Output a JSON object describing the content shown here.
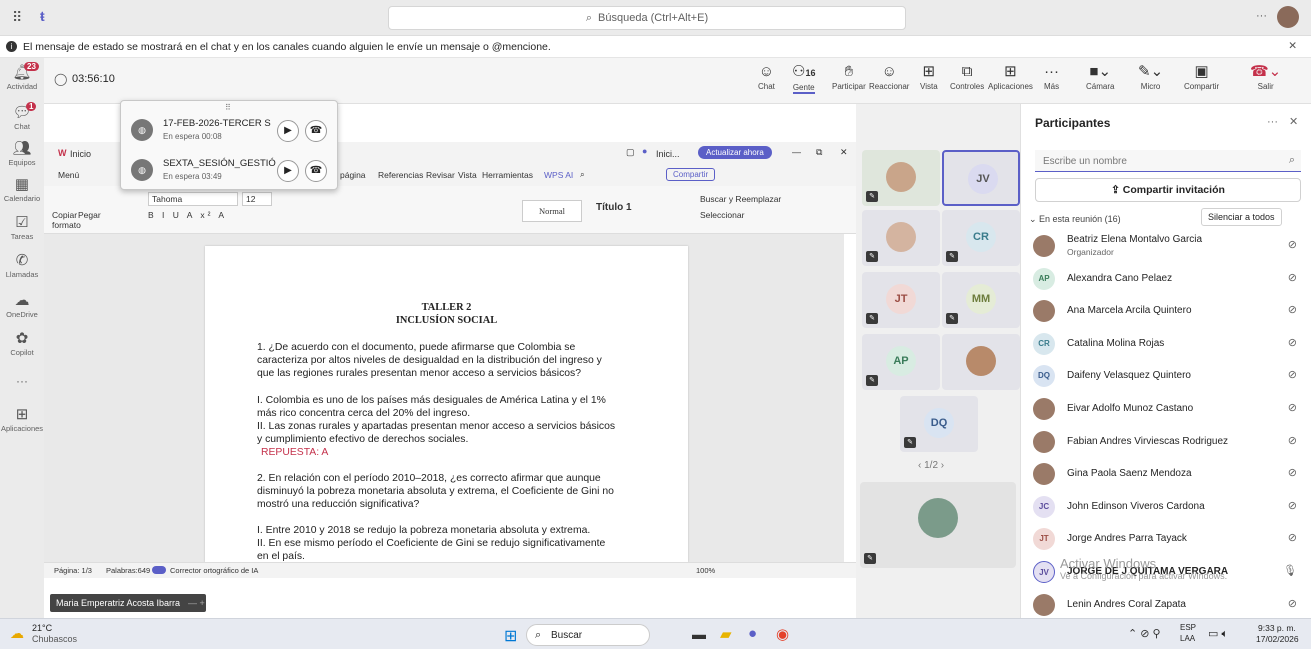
{
  "topbar": {
    "search_placeholder": "Búsqueda (Ctrl+Alt+E)",
    "more": "···"
  },
  "infobar": {
    "message": "El mensaje de estado se mostrará en el chat y en los canales cuando alguien le envíe un mensaje o @mencione.",
    "close": "✕"
  },
  "rail": [
    {
      "label": "Actividad",
      "badge": "23"
    },
    {
      "label": "Chat",
      "badge": "1"
    },
    {
      "label": "Equipos"
    },
    {
      "label": "Calendario"
    },
    {
      "label": "Tareas"
    },
    {
      "label": "Llamadas"
    },
    {
      "label": "OneDrive"
    },
    {
      "label": "Copilot"
    },
    {
      "label": "···"
    },
    {
      "label": "Aplicaciones"
    }
  ],
  "meeting": {
    "timer": "03:56:10",
    "people_count": "16",
    "buttons": {
      "chat": "Chat",
      "people": "Gente",
      "raise": "Participar",
      "react": "Reaccionar",
      "view": "Vista",
      "controls": "Controles",
      "apps": "Aplicaciones",
      "more": "Más",
      "camera": "Cámara",
      "mic": "Micro",
      "share": "Compartir",
      "leave": "Salir"
    }
  },
  "held_calls": [
    {
      "title": "17-FEB-2026-TERCER S",
      "status": "En espera  00:08"
    },
    {
      "title": "SEXTA_SESIÓN_GESTIÓ",
      "status": "En espera  03:49"
    }
  ],
  "word": {
    "tab_home": "Inicio",
    "menu": "Menú",
    "tabs": [
      "página",
      "Referencias",
      "Revisar",
      "Vista",
      "Herramientas",
      "WPS AI"
    ],
    "start_label": "Inici...",
    "update": "Actualizar ahora",
    "share": "Compartir",
    "copy": "Copiar",
    "paste": "Pegar",
    "format": "formato",
    "font": "Tahoma",
    "size": "12",
    "style_normal": "Normal",
    "style_title": "Título 1",
    "find": "Buscar y Reemplazar",
    "select": "Seleccionar",
    "status_page": "Página: 1/3",
    "status_words": "Palabras:649",
    "status_spell": "Corrector ortográfico de IA",
    "zoom": "100%"
  },
  "document": {
    "title1": "TALLER 2",
    "title2": "INCLUSÍON SOCIAL",
    "q1": "1. ¿De acuerdo con el documento, puede afirmarse que Colombia se caracteriza por altos niveles de desigualdad en la distribución del ingreso y que las regiones rurales presentan menor acceso a servicios básicos?",
    "q1_i": "I. Colombia es uno de los países más desiguales de América Latina y el 1% más rico concentra cerca del 20% del ingreso.",
    "q1_ii": "II. Las zonas rurales y apartadas presentan menor acceso a servicios básicos y cumplimiento efectivo de derechos sociales.",
    "answer": "REPUESTA: A",
    "q2": "2. En relación con el período 2010–2018, ¿es correcto afirmar que aunque disminuyó la pobreza monetaria absoluta y extrema, el Coeficiente de Gini no mostró una reducción significativa?",
    "q2_i": "I. Entre 2010 y 2018 se redujo la pobreza monetaria absoluta y extrema.",
    "q2_ii": "II. En ese mismo período el Coeficiente de Gini se redujo significativamente en el país."
  },
  "presenter_tag": "Maria Emperatriz Acosta Ibarra",
  "gallery": {
    "page": "1/2",
    "tiles": [
      "JV",
      "CR",
      "JT",
      "MM",
      "AP",
      "DQ"
    ]
  },
  "participants": {
    "title": "Participantes",
    "search_placeholder": "Escribe un nombre",
    "share_invite": "Compartir invitación",
    "section": "En esta reunión (16)",
    "mute_all": "Silenciar a todos",
    "organizer": "Organizador",
    "list": [
      {
        "initials": "",
        "name": "Beatriz Elena Montalvo Garcia"
      },
      {
        "initials": "AP",
        "name": "Alexandra Cano Pelaez"
      },
      {
        "initials": "",
        "name": "Ana Marcela Arcila Quintero"
      },
      {
        "initials": "CR",
        "name": "Catalina Molina Rojas"
      },
      {
        "initials": "DQ",
        "name": "Daifeny Velasquez Quintero"
      },
      {
        "initials": "",
        "name": "Eivar Adolfo Munoz Castano"
      },
      {
        "initials": "",
        "name": "Fabian Andres Virviescas Rodriguez"
      },
      {
        "initials": "",
        "name": "Gina Paola Saenz Mendoza"
      },
      {
        "initials": "JC",
        "name": "John Edinson Viveros Cardona"
      },
      {
        "initials": "JT",
        "name": "Jorge Andres Parra Tayack"
      },
      {
        "initials": "JV",
        "name": "JORGE DE J QUITAMA VERGARA"
      },
      {
        "initials": "",
        "name": "Lenin Andres Coral Zapata"
      }
    ]
  },
  "watermark": {
    "line1": "Activar Windows",
    "line2": "Ve a Configuración para activar Windows."
  },
  "taskbar": {
    "temp": "21°C",
    "weather": "Chubascos",
    "search": "Buscar",
    "lang1": "ESP",
    "lang2": "LAA",
    "time": "9:33 p. m.",
    "date": "17/02/2026"
  }
}
